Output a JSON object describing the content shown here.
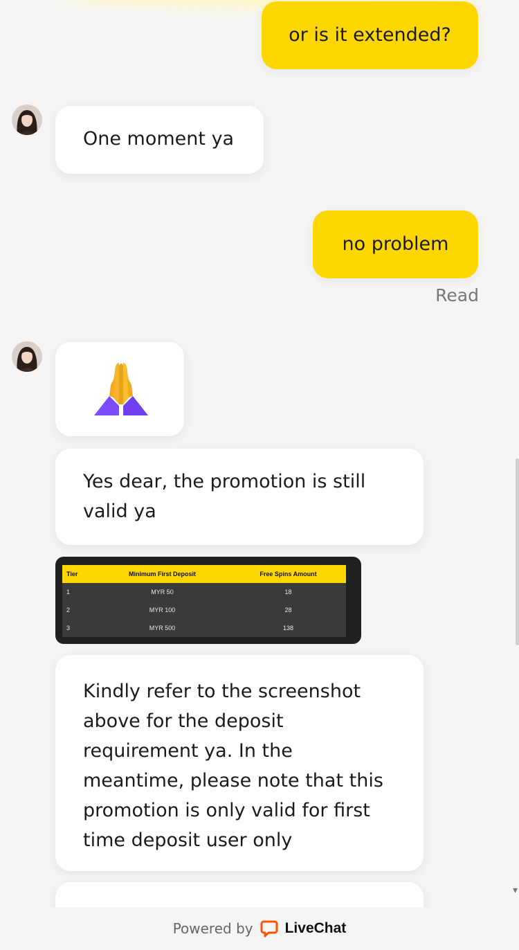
{
  "messages": [
    {
      "sender": "visitor",
      "text": "or is it extended?"
    },
    {
      "sender": "agent",
      "text": "One moment ya"
    },
    {
      "sender": "visitor",
      "text": "no problem"
    },
    {
      "sender": "agent",
      "type": "emoji",
      "icon": "folded-hands-emoji"
    },
    {
      "sender": "agent",
      "text": "Yes dear, the promotion is still valid ya"
    },
    {
      "sender": "agent",
      "text": "Kindly refer to the screenshot above for the deposit requirement ya. In the meantime, please note that this promotion is only valid for first time deposit user only"
    }
  ],
  "read_status": "Read",
  "promo_table": {
    "headers": [
      "Tier",
      "Minimum First Deposit",
      "Free Spins Amount"
    ],
    "rows": [
      [
        "1",
        "MYR 50",
        "18"
      ],
      [
        "2",
        "MYR 100",
        "28"
      ],
      [
        "3",
        "MYR 500",
        "138"
      ]
    ]
  },
  "footer": {
    "powered_by": "Powered by",
    "brand": "LiveChat",
    "brand_color": "#ff5100"
  },
  "colors": {
    "visitor_bubble": "#ffd700",
    "agent_bubble": "#ffffff",
    "background": "#f5f5f5"
  }
}
